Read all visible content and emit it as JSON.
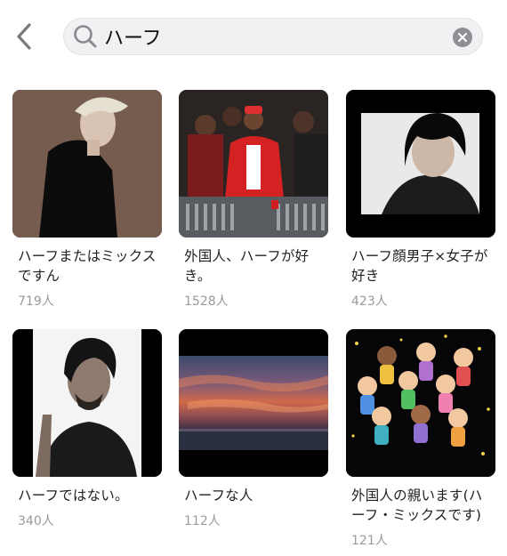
{
  "search": {
    "query": "ハーフ"
  },
  "icons": {
    "back": "chevron-left-icon",
    "search": "magnifier-icon",
    "clear": "clear-x-icon"
  },
  "colors": {
    "search_bg": "#f1f1f3",
    "count_text": "#9a9a9a",
    "clear_bg": "#8e8e93"
  },
  "communities": [
    {
      "title": "ハーフまたはミックスですん",
      "members": "719人"
    },
    {
      "title": "外国人、ハーフが好き。",
      "members": "1528人"
    },
    {
      "title": "ハーフ顔男子×女子が好き",
      "members": "423人"
    },
    {
      "title": "ハーフではない。",
      "members": "340人"
    },
    {
      "title": "ハーフな人",
      "members": "112人"
    },
    {
      "title": "外国人の親います(ハーフ・ミックスです)",
      "members": "121人"
    }
  ]
}
